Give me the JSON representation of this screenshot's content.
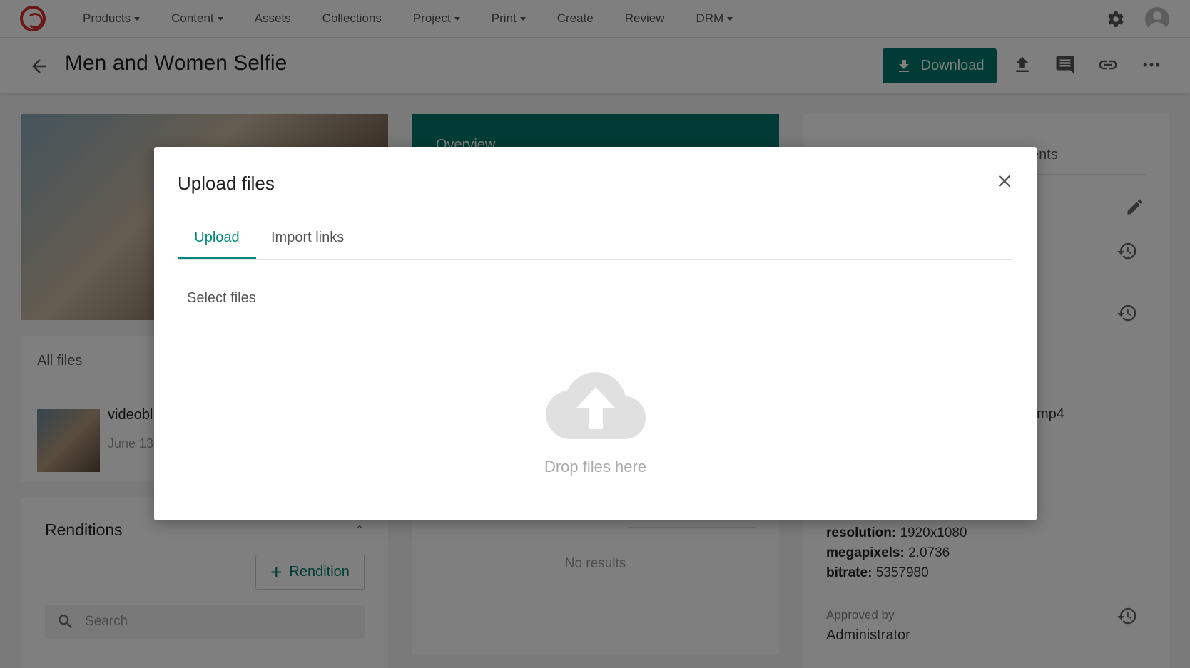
{
  "nav": {
    "items": [
      {
        "label": "Products",
        "dropdown": true
      },
      {
        "label": "Content",
        "dropdown": true
      },
      {
        "label": "Assets",
        "dropdown": false
      },
      {
        "label": "Collections",
        "dropdown": false
      },
      {
        "label": "Project",
        "dropdown": true
      },
      {
        "label": "Print",
        "dropdown": true
      },
      {
        "label": "Create",
        "dropdown": false
      },
      {
        "label": "Review",
        "dropdown": false
      },
      {
        "label": "DRM",
        "dropdown": true
      }
    ]
  },
  "header": {
    "title": "Men and Women Selfie",
    "download_label": "Download"
  },
  "background": {
    "all_files_title": "All files",
    "file_name": "videobl",
    "file_date": "June 13",
    "renditions_title": "Renditions",
    "rendition_button": "Rendition",
    "search_placeholder": "Search",
    "overview_title": "Overview",
    "no_results": "No results",
    "meta_tab": "ents",
    "meta_ext": "mp4",
    "resolution_label": "resolution:",
    "resolution_value": "1920x1080",
    "megapixels_label": "megapixels:",
    "megapixels_value": "2.0736",
    "bitrate_label": "bitrate:",
    "bitrate_value": "5357980",
    "approved_label": "Approved by",
    "approved_value": "Administrator"
  },
  "modal": {
    "title": "Upload files",
    "tabs": [
      {
        "label": "Upload",
        "active": true
      },
      {
        "label": "Import links",
        "active": false
      }
    ],
    "select_files": "Select files",
    "drop_text": "Drop files here"
  },
  "colors": {
    "accent": "#00796b",
    "tab_active": "#00897b",
    "logo": "#d32f2f"
  }
}
